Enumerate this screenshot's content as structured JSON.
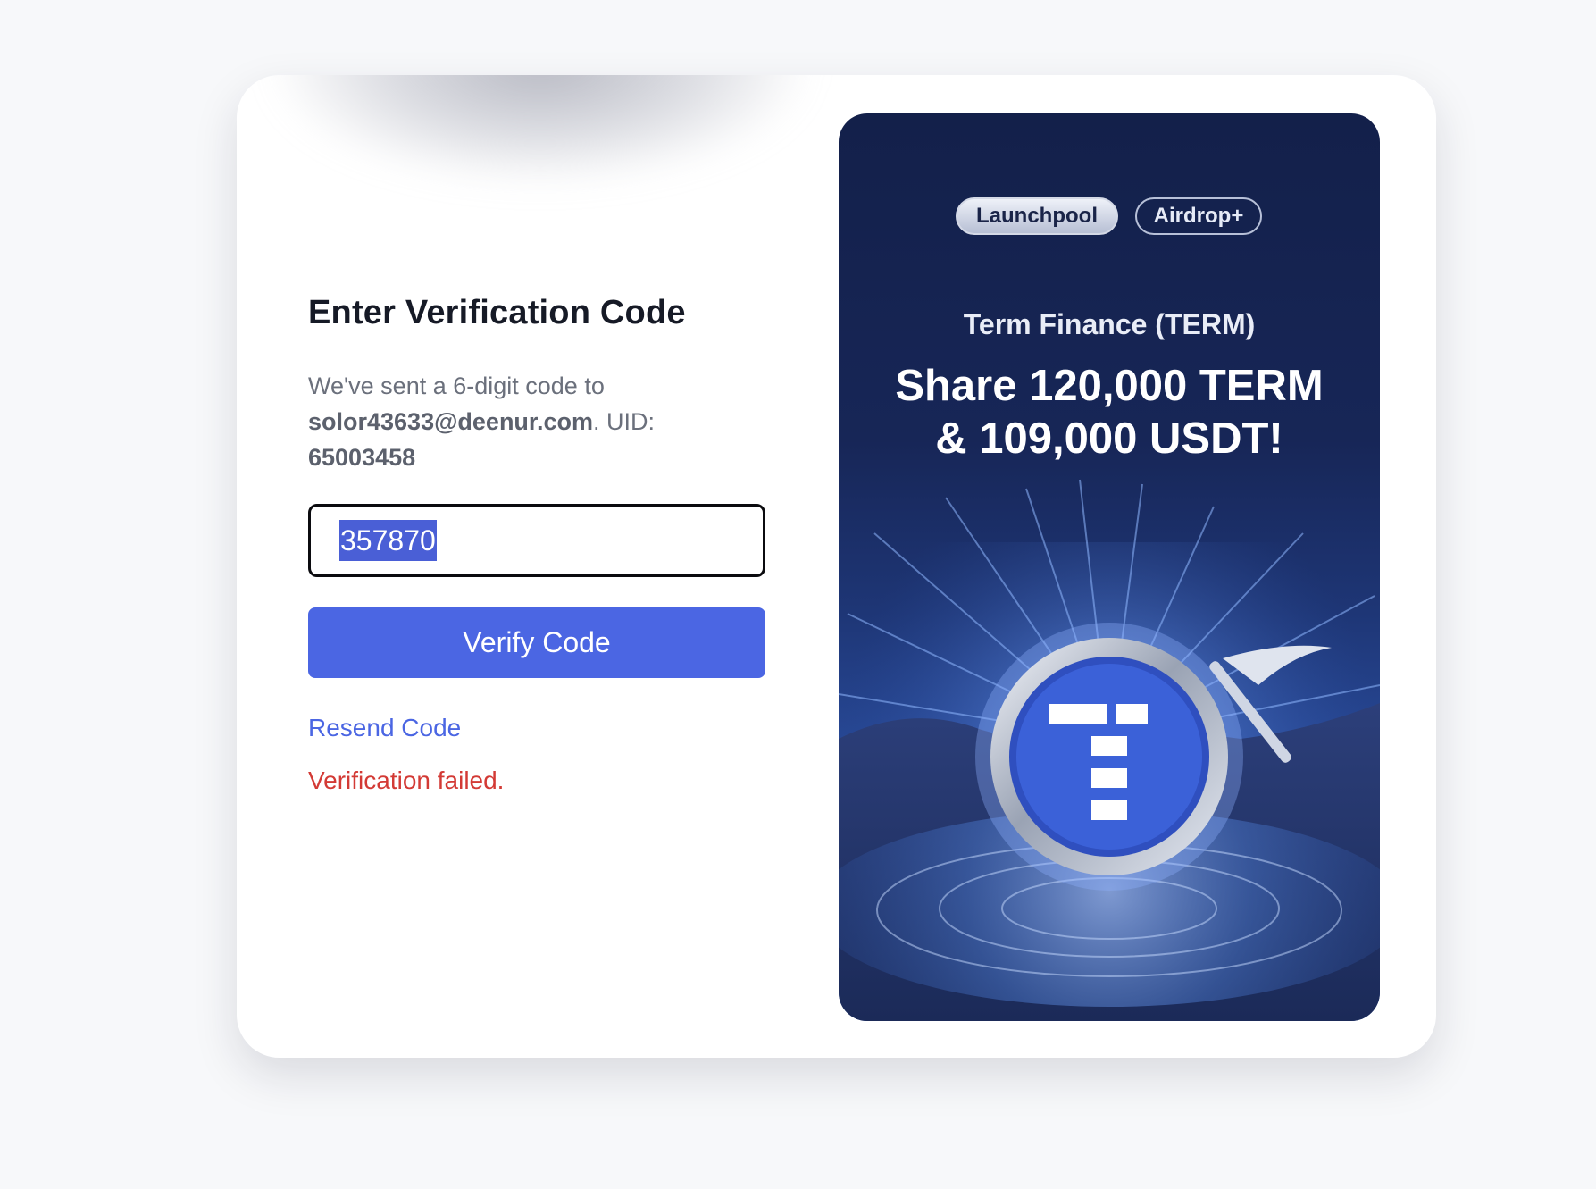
{
  "verify": {
    "title": "Enter Verification Code",
    "desc_prefix": "We've sent a 6-digit code to ",
    "email": "solor43633@deenur.com",
    "desc_uid_label": ". UID: ",
    "uid": "65003458",
    "code_value": "357870",
    "verify_button": "Verify Code",
    "resend_link": "Resend Code",
    "error_message": "Verification failed."
  },
  "promo": {
    "tag_launchpool": "Launchpool",
    "tag_airdrop": "Airdrop+",
    "subtitle": "Term Finance (TERM)",
    "headline_line1": "Share 120,000 TERM",
    "headline_line2": "& 109,000 USDT!"
  },
  "colors": {
    "accent": "#4b66e3",
    "error": "#d33a35",
    "promo_bg": "#172657"
  },
  "icons": {
    "coin": "term-coin-icon",
    "pickaxe": "pickaxe-icon"
  }
}
